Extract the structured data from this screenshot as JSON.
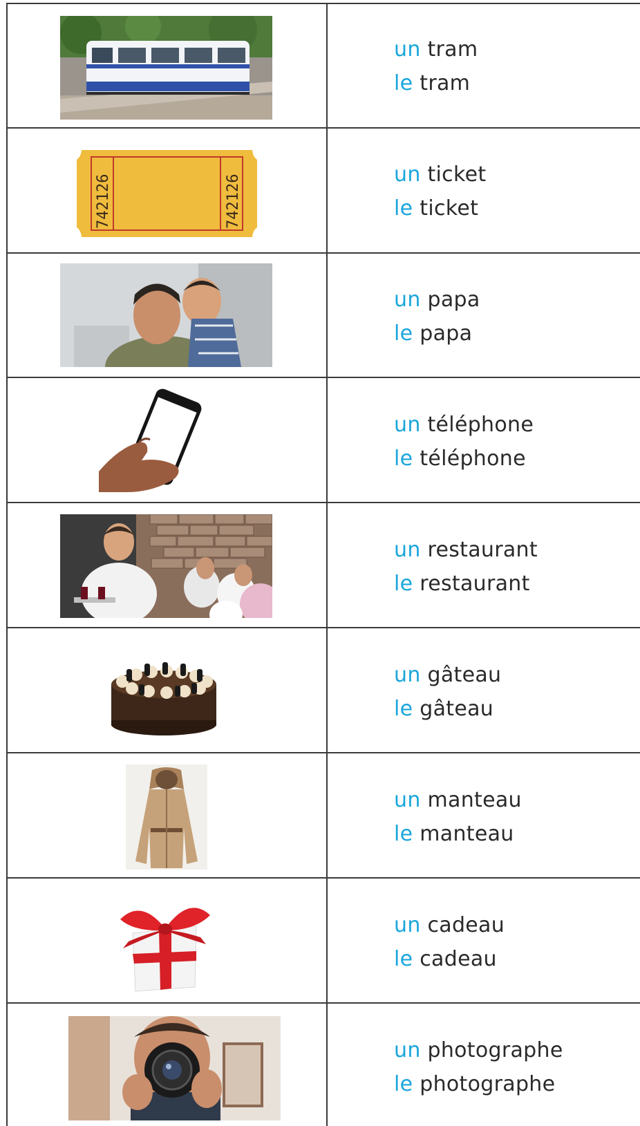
{
  "accent_color": "#1aa6dc",
  "rows": [
    {
      "indef": "un",
      "def": "le",
      "noun": "tram",
      "image": "tram-photo"
    },
    {
      "indef": "un",
      "def": "le",
      "noun": "ticket",
      "image": "ticket-photo",
      "ticket_number": "742126"
    },
    {
      "indef": "un",
      "def": "le",
      "noun": "papa",
      "image": "father-son-photo"
    },
    {
      "indef": "un",
      "def": "le",
      "noun": "téléphone",
      "image": "phone-in-hand-photo"
    },
    {
      "indef": "un",
      "def": "le",
      "noun": "restaurant",
      "image": "restaurant-waiter-photo"
    },
    {
      "indef": "un",
      "def": "le",
      "noun": "gâteau",
      "image": "chocolate-cake-photo"
    },
    {
      "indef": "un",
      "def": "le",
      "noun": "manteau",
      "image": "coat-photo"
    },
    {
      "indef": "un",
      "def": "le",
      "noun": "cadeau",
      "image": "gift-box-photo"
    },
    {
      "indef": "un",
      "def": "le",
      "noun": "photographe",
      "image": "photographer-photo"
    }
  ]
}
